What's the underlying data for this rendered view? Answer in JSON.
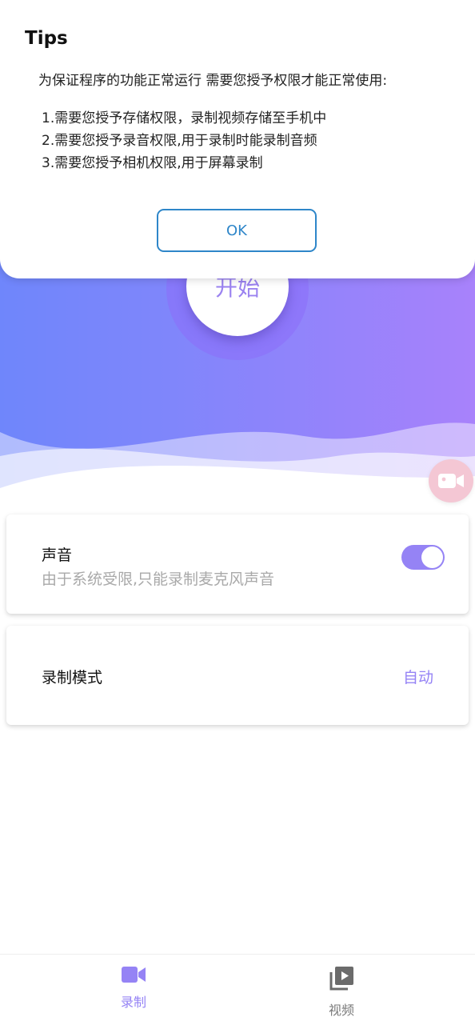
{
  "dialog": {
    "title": "Tips",
    "intro": "为保证程序的功能正常运行 需要您授予权限才能正常使用:",
    "items": [
      "1.需要您授予存储权限，录制视频存储至手机中",
      "2.需要您授予录音权限,用于录制时能录制音频",
      "3.需要您授予相机权限,用于屏幕录制"
    ],
    "ok_label": "OK"
  },
  "hero": {
    "start_label": "开始",
    "float_icon": "video-camera-icon"
  },
  "sound": {
    "title": "声音",
    "subtitle": "由于系统受限,只能录制麦克风声音",
    "enabled": true
  },
  "mode": {
    "title": "录制模式",
    "value": "自动"
  },
  "nav": {
    "items": [
      {
        "label": "录制",
        "icon": "video-camera-icon",
        "active": true
      },
      {
        "label": "视频",
        "icon": "video-library-icon",
        "active": false
      }
    ]
  },
  "colors": {
    "accent": "#9583f5",
    "ok_border": "#2e86c9",
    "hero_start": "#6f86fb",
    "hero_end": "#a882fb"
  }
}
